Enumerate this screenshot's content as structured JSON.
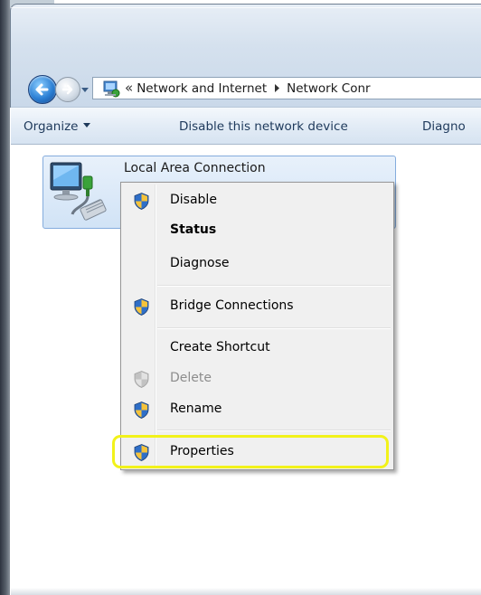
{
  "address_bar": {
    "chevrons": "«",
    "crumbs": [
      "Network and Internet",
      "Network Conr"
    ]
  },
  "toolbar": {
    "organize": "Organize",
    "disable": "Disable this network device",
    "diagnose": "Diagno"
  },
  "connection": {
    "name": "Local Area Connection"
  },
  "context_menu": {
    "items": [
      {
        "label": "Disable",
        "shield": true,
        "bold": false,
        "disabled": false
      },
      {
        "label": "Status",
        "shield": false,
        "bold": true,
        "disabled": false
      },
      {
        "label": "Diagnose",
        "shield": false,
        "bold": false,
        "disabled": false
      },
      {
        "label": "Bridge Connections",
        "shield": true,
        "bold": false,
        "disabled": false
      },
      {
        "label": "Create Shortcut",
        "shield": false,
        "bold": false,
        "disabled": false
      },
      {
        "label": "Delete",
        "shield": true,
        "bold": false,
        "disabled": true
      },
      {
        "label": "Rename",
        "shield": true,
        "bold": false,
        "disabled": false
      },
      {
        "label": "Properties",
        "shield": true,
        "bold": false,
        "disabled": false
      }
    ]
  },
  "colors": {
    "highlight": "#f2f21a",
    "toolbar_text": "#1e395b",
    "selection_border": "#84acdd"
  }
}
